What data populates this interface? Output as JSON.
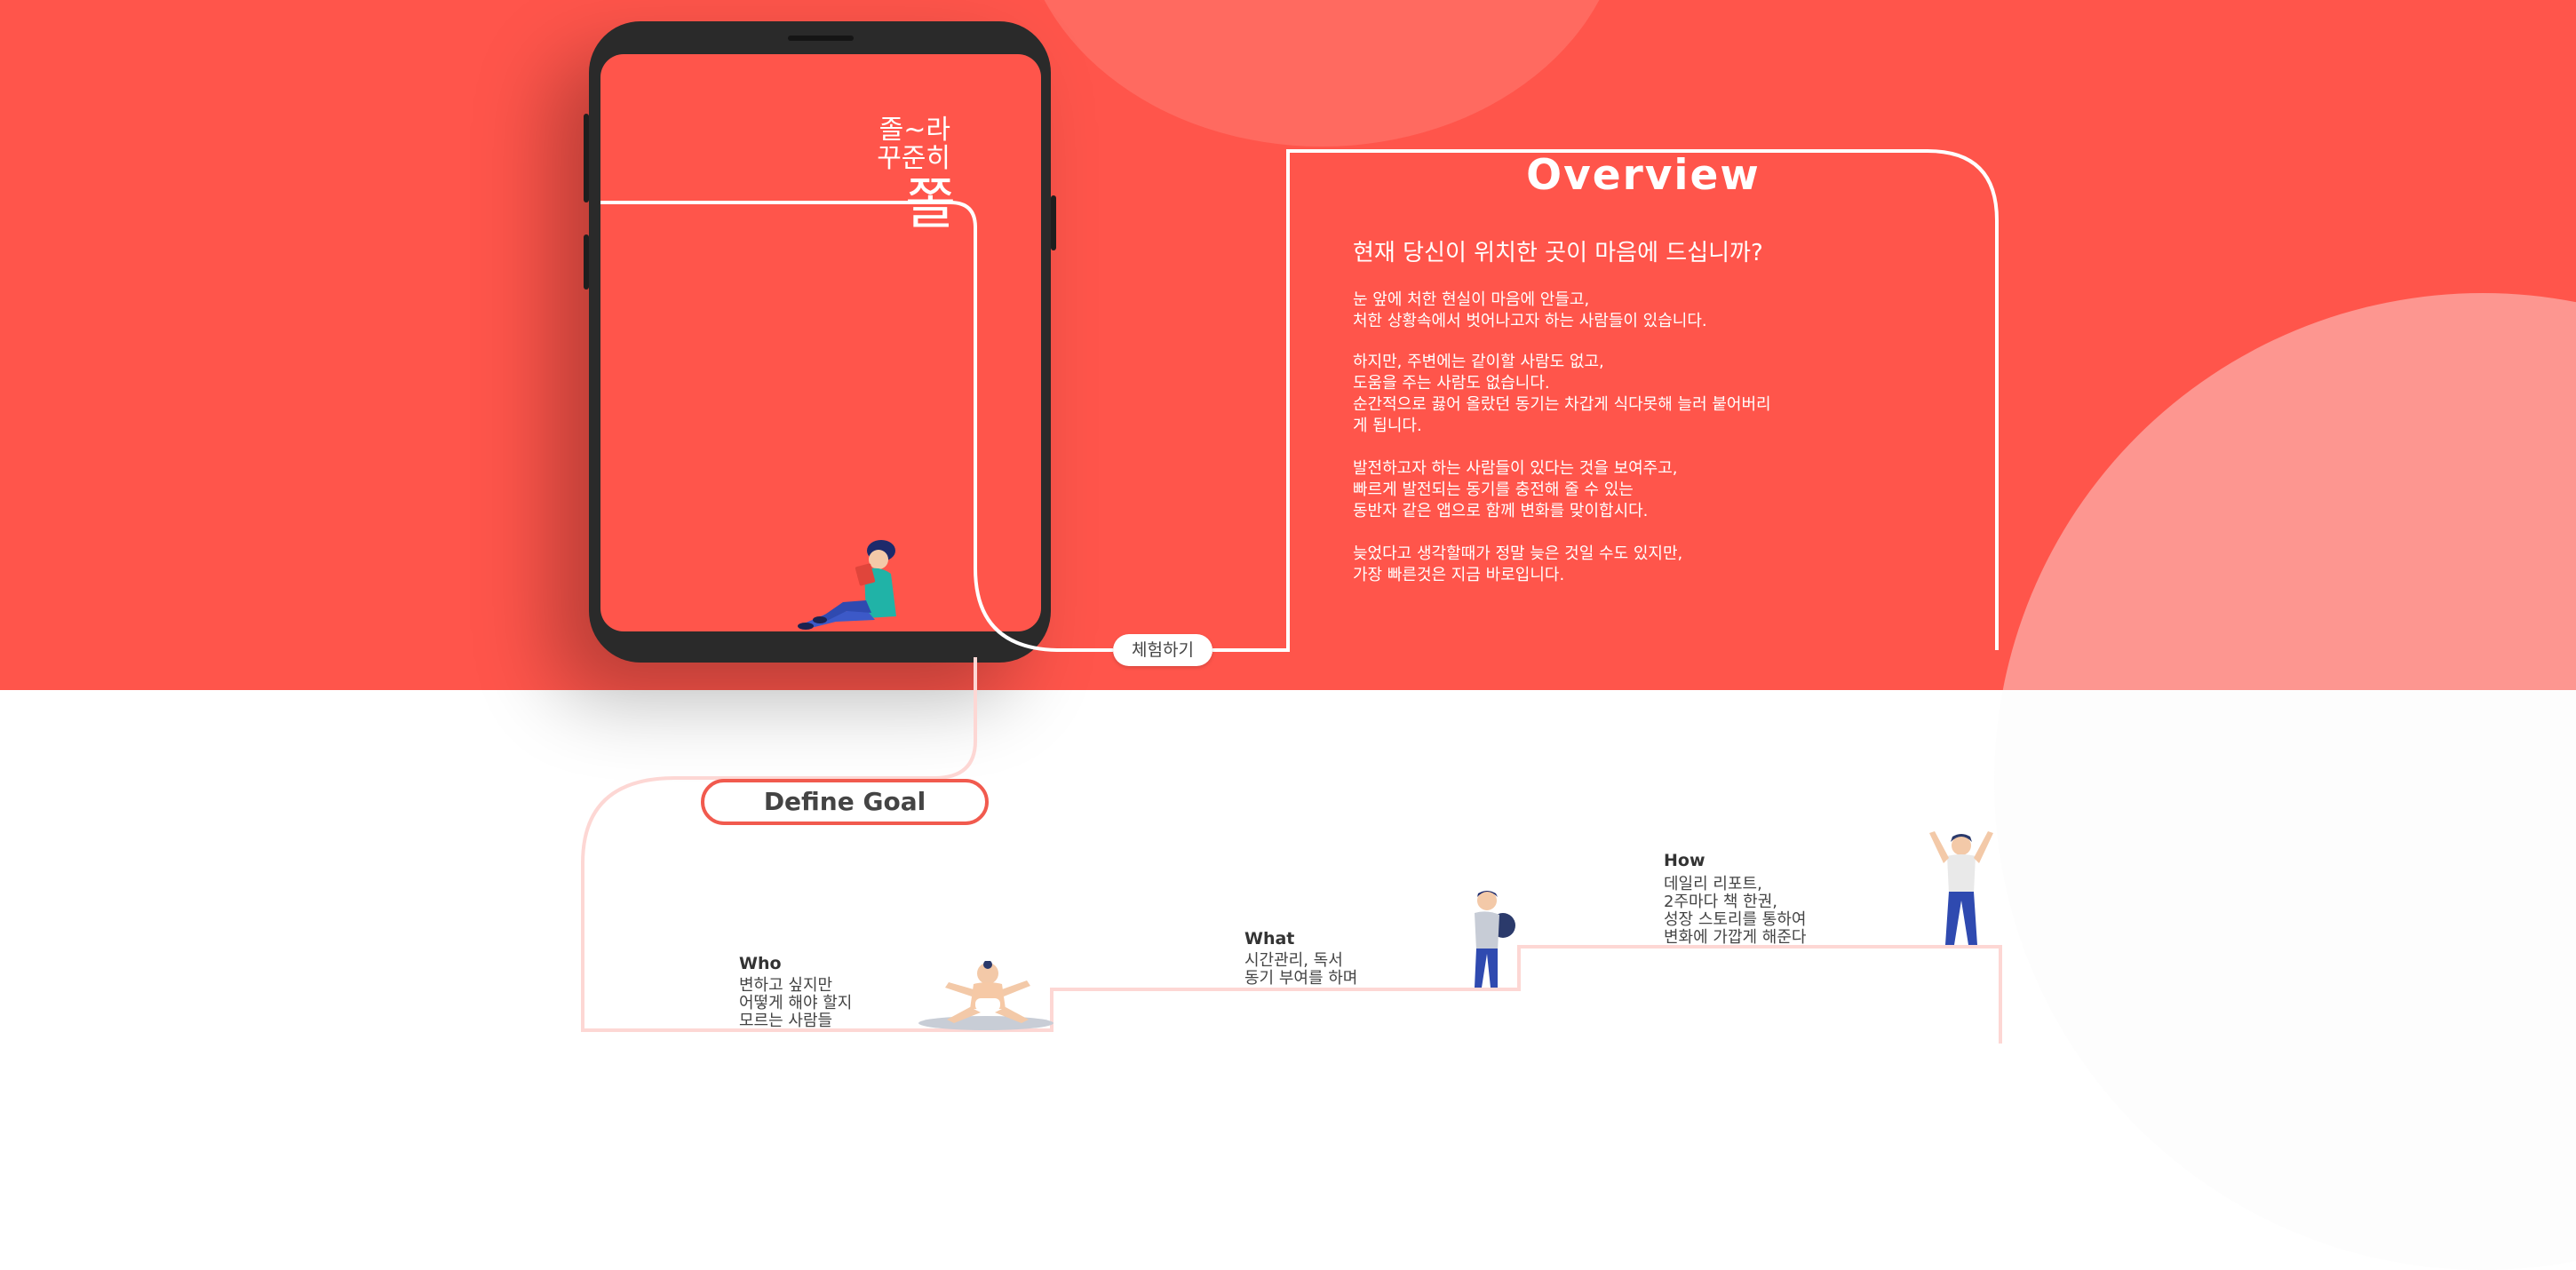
{
  "app": {
    "logo_lines": [
      "졸~라",
      "꾸준히",
      "쫄"
    ]
  },
  "overview": {
    "title": "Overview",
    "heading": "현재 당신이 위치한 곳이 마음에 드십니까?",
    "paragraphs": [
      [
        "  눈 앞에 처한 현실이 마음에 안들고,",
        "처한 상황속에서 벗어나고자 하는 사람들이 있습니다."
      ],
      [
        "하지만, 주변에는 같이할 사람도 없고,",
        "도움을 주는 사람도 없습니다.",
        "순간적으로 끓어 올랐던 동기는 차갑게 식다못해 늘러 붙어버리",
        "게 됩니다."
      ],
      [
        "발전하고자 하는 사람들이 있다는 것을 보여주고,",
        "빠르게 발전되는 동기를 충전해 줄 수 있는",
        "동반자 같은 앱으로 함께 변화를 맞이합시다."
      ],
      [
        "  늦었다고 생각할때가 정말 늦은 것일 수도 있지만,",
        "가장 빠른것은 지금 바로입니다."
      ]
    ],
    "cta_label": "체험하기"
  },
  "define_goal": {
    "label": "Define Goal",
    "steps": [
      {
        "title": "Who",
        "lines": [
          "변하고 싶지만",
          "어떻게 해야 할지",
          "모르는 사람들"
        ]
      },
      {
        "title": "What",
        "lines": [
          "시간관리, 독서",
          "동기 부여를 하며"
        ]
      },
      {
        "title": "How",
        "lines": [
          "데일리 리포트,",
          "2주마다 책 한권,",
          "성장 스토리를 통하여",
          "변화에 가깝게 해준다"
        ]
      }
    ]
  },
  "colors": {
    "accent": "#ff554b",
    "accent_light": "#ff6a60",
    "line_pink": "#fdd7d4",
    "phone_body": "#2a2a2a"
  },
  "icons": [
    "person-reading-illustration",
    "baby-illustration",
    "student-illustration",
    "cheering-person-illustration"
  ]
}
